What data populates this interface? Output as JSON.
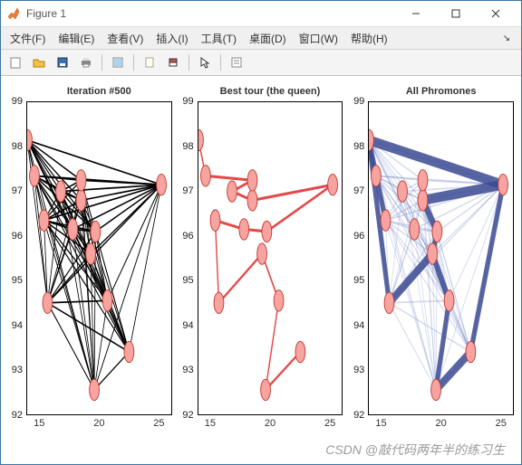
{
  "window": {
    "title": "Figure 1"
  },
  "menu": {
    "file": "文件(F)",
    "edit": "编辑(E)",
    "view": "查看(V)",
    "insert": "插入(I)",
    "tools": "工具(T)",
    "desktop": "桌面(D)",
    "window": "窗口(W)",
    "help": "帮助(H)"
  },
  "watermark": "CSDN @敲代码两年半的练习生",
  "chart_data": [
    {
      "type": "scatter",
      "title": "Iteration #500",
      "xlim": [
        14,
        26
      ],
      "ylim": [
        92,
        99
      ],
      "xticks": [
        15,
        20,
        25
      ],
      "yticks": [
        92,
        93,
        94,
        95,
        96,
        97,
        98,
        99
      ],
      "nodes": [
        {
          "x": 14.0,
          "y": 98.15
        },
        {
          "x": 14.6,
          "y": 97.35
        },
        {
          "x": 15.4,
          "y": 96.35
        },
        {
          "x": 16.8,
          "y": 97.0
        },
        {
          "x": 18.5,
          "y": 96.8
        },
        {
          "x": 19.7,
          "y": 96.1
        },
        {
          "x": 18.5,
          "y": 97.25
        },
        {
          "x": 17.8,
          "y": 96.15
        },
        {
          "x": 15.7,
          "y": 94.5
        },
        {
          "x": 19.3,
          "y": 95.6
        },
        {
          "x": 20.7,
          "y": 94.55
        },
        {
          "x": 25.2,
          "y": 97.15
        },
        {
          "x": 22.5,
          "y": 93.4
        },
        {
          "x": 19.6,
          "y": 92.55
        }
      ],
      "edges": "full_graph_black"
    },
    {
      "type": "line",
      "title": "Best tour (the queen)",
      "xlim": [
        14,
        26
      ],
      "ylim": [
        92,
        99
      ],
      "xticks": [
        15,
        20,
        25
      ],
      "yticks": [
        92,
        93,
        94,
        95,
        96,
        97,
        98,
        99
      ],
      "tour_order": [
        0,
        1,
        6,
        3,
        4,
        11,
        5,
        7,
        2,
        8,
        9,
        10,
        13,
        12
      ],
      "line_color": "#e34a4a"
    },
    {
      "type": "scatter",
      "title": "All Phromones",
      "xlim": [
        14,
        26
      ],
      "ylim": [
        92,
        99
      ],
      "xticks": [
        15,
        20,
        25
      ],
      "yticks": [
        92,
        93,
        94,
        95,
        96,
        97,
        98,
        99
      ],
      "pheromone_edges_color": "#5a6fc0",
      "strong_edges": [
        [
          0,
          11
        ],
        [
          11,
          4
        ],
        [
          4,
          5
        ],
        [
          5,
          9
        ],
        [
          9,
          10
        ],
        [
          10,
          13
        ],
        [
          13,
          12
        ],
        [
          12,
          11
        ],
        [
          8,
          9
        ],
        [
          0,
          2
        ],
        [
          0,
          8
        ]
      ]
    }
  ]
}
